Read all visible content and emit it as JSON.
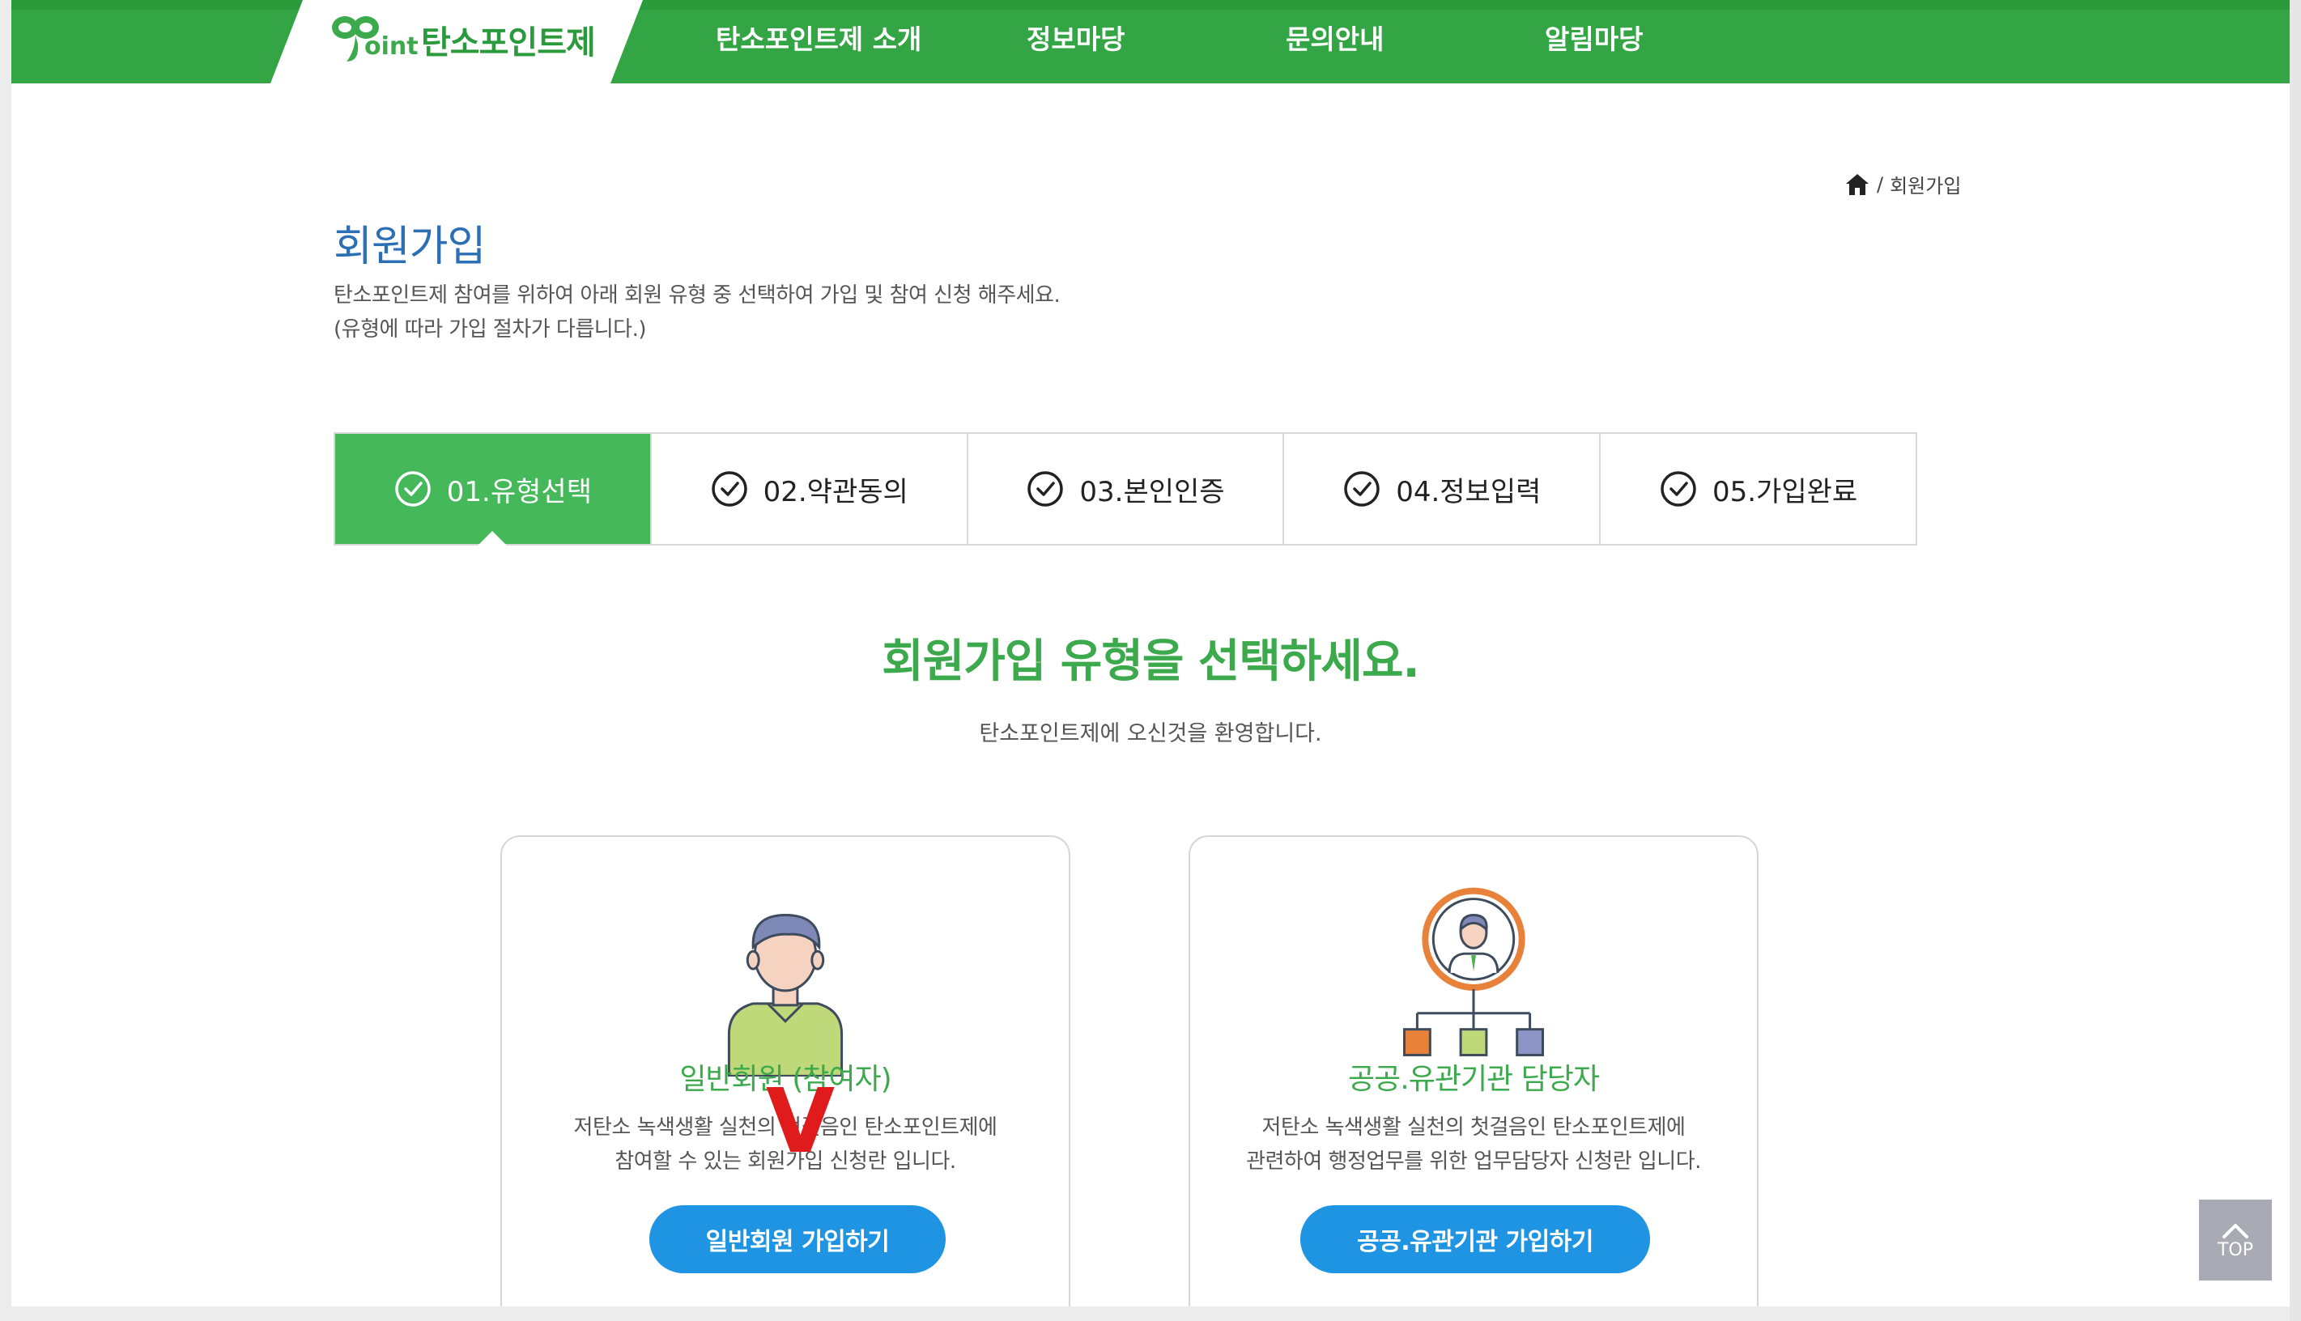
{
  "header": {
    "logo_text": "탄소포인트제",
    "logo_mark_text": "oint",
    "nav": [
      "탄소포인트제 소개",
      "정보마당",
      "문의안내",
      "알림마당"
    ]
  },
  "breadcrumb": {
    "separator": "/",
    "current": "회원가입"
  },
  "page": {
    "title": "회원가입",
    "desc_line1": "탄소포인트제 참여를 위하여 아래 회원 유형 중 선택하여 가입 및 참여 신청 해주세요.",
    "desc_line2": "(유형에 따라 가입 절차가 다릅니다.)"
  },
  "steps": [
    {
      "label": "01.유형선택",
      "active": true
    },
    {
      "label": "02.약관동의",
      "active": false
    },
    {
      "label": "03.본인인증",
      "active": false
    },
    {
      "label": "04.정보입력",
      "active": false
    },
    {
      "label": "05.가입완료",
      "active": false
    }
  ],
  "selection": {
    "title": "회원가입 유형을 선택하세요.",
    "subtitle": "탄소포인트제에 오신것을 환영합니다."
  },
  "cards": [
    {
      "title": "일반회원 (참여자)",
      "desc_line1": "저탄소 녹색생활 실천의 첫걸음인 탄소포인트제에",
      "desc_line2": "참여할 수 있는 회원가입 신청란 입니다.",
      "button": "일반회원 가입하기"
    },
    {
      "title": "공공.유관기관 담당자",
      "desc_line1": "저탄소 녹색생활 실천의 첫걸음인 탄소포인트제에",
      "desc_line2": "관련하여 행정업무를 위한 업무담당자 신청란 입니다.",
      "button": "공공.유관기관 가입하기"
    }
  ],
  "annotation_mark": "V",
  "top_button": "TOP",
  "colors": {
    "brand_green": "#33a544",
    "step_active": "#45b85a",
    "title_blue": "#2d6fb5",
    "button_blue": "#1e94e2",
    "annotation_red": "#e01b1b"
  }
}
